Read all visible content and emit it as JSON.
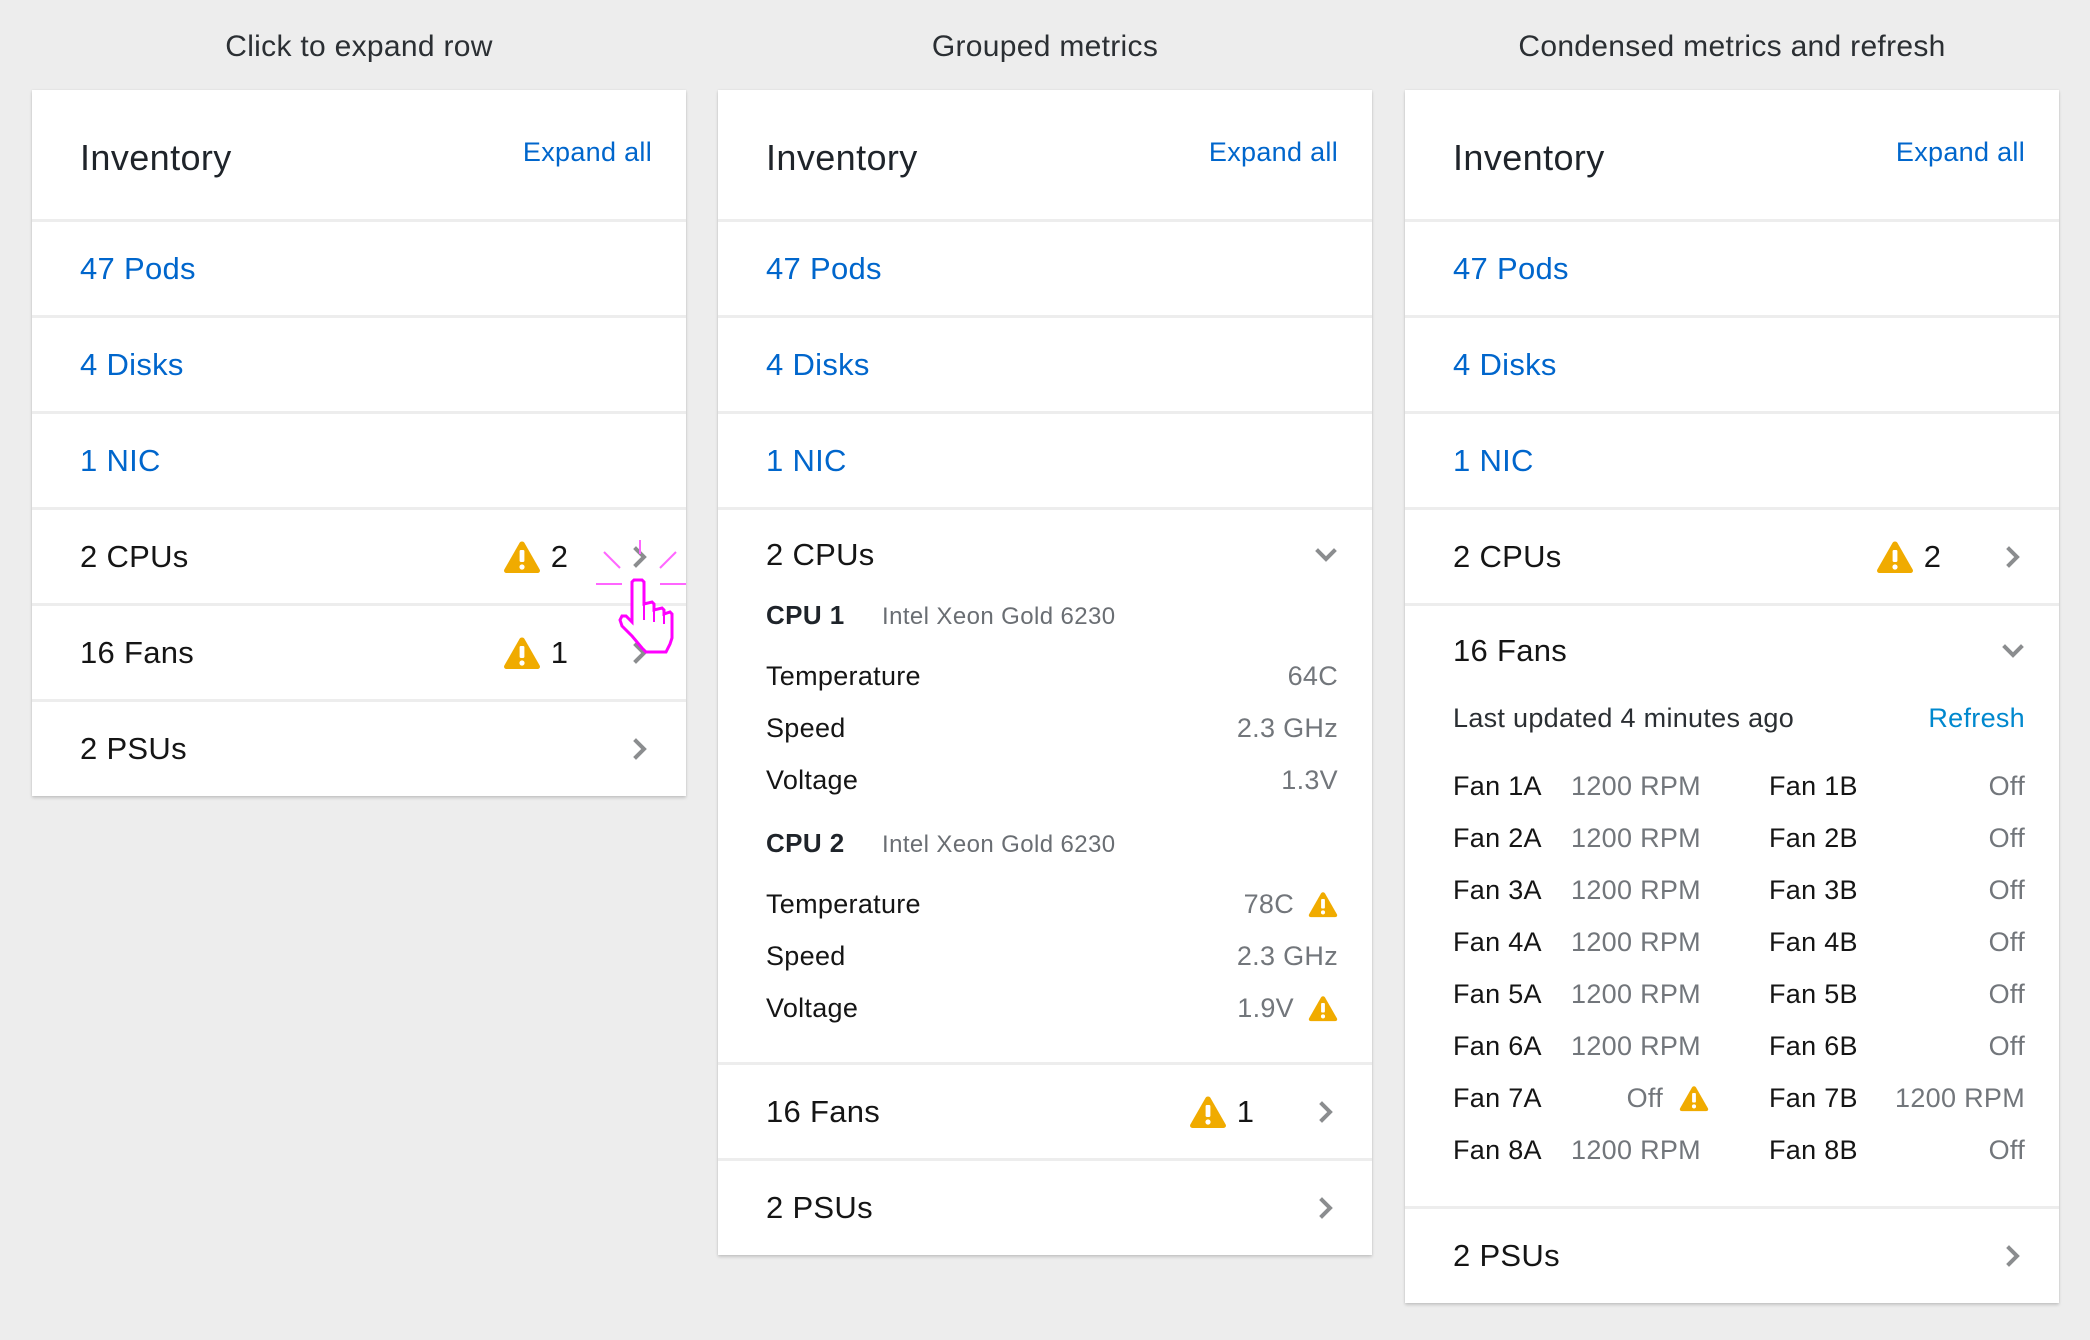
{
  "colors": {
    "background": "#ededed",
    "link": "#0066cc",
    "refresh_link": "#0088ce",
    "warning": "#f0ab00",
    "muted_text": "#72767b",
    "chevron": "#8b8d8f",
    "cursor_highlight": "#ff00ff"
  },
  "columns": [
    {
      "heading": "Click to expand row",
      "panel": {
        "title": "Inventory",
        "expand_all": "Expand all",
        "rows": [
          {
            "label": "47 Pods",
            "type": "link"
          },
          {
            "label": "4 Disks",
            "type": "link"
          },
          {
            "label": "1 NIC",
            "type": "link"
          },
          {
            "label": "2 CPUs",
            "type": "expandable",
            "alert_icon": "warning-icon",
            "alert_count": "2",
            "chevron": "chevron-right-icon"
          },
          {
            "label": "16 Fans",
            "type": "expandable",
            "alert_icon": "warning-icon",
            "alert_count": "1",
            "chevron": "chevron-right-icon"
          },
          {
            "label": "2 PSUs",
            "type": "expandable",
            "chevron": "chevron-right-icon"
          }
        ]
      },
      "cursor": "hand-pointer-click-icon"
    },
    {
      "heading": "Grouped metrics",
      "panel": {
        "title": "Inventory",
        "expand_all": "Expand all",
        "rows": [
          {
            "label": "47 Pods",
            "type": "link"
          },
          {
            "label": "4 Disks",
            "type": "link"
          },
          {
            "label": "1 NIC",
            "type": "link"
          },
          {
            "label": "2 CPUs",
            "type": "expanded",
            "chevron": "chevron-down-icon"
          },
          {
            "label": "16 Fans",
            "type": "expandable",
            "alert_icon": "warning-icon",
            "alert_count": "1",
            "chevron": "chevron-right-icon"
          },
          {
            "label": "2 PSUs",
            "type": "expandable",
            "chevron": "chevron-right-icon"
          }
        ],
        "cpus": [
          {
            "name": "CPU 1",
            "model": "Intel Xeon Gold 6230",
            "metrics": [
              {
                "label": "Temperature",
                "value": "64C",
                "warning": false
              },
              {
                "label": "Speed",
                "value": "2.3 GHz",
                "warning": false
              },
              {
                "label": "Voltage",
                "value": "1.3V",
                "warning": false
              }
            ]
          },
          {
            "name": "CPU 2",
            "model": "Intel Xeon Gold 6230",
            "metrics": [
              {
                "label": "Temperature",
                "value": "78C",
                "warning": true
              },
              {
                "label": "Speed",
                "value": "2.3 GHz",
                "warning": false
              },
              {
                "label": "Voltage",
                "value": "1.9V",
                "warning": true
              }
            ]
          }
        ]
      }
    },
    {
      "heading": "Condensed metrics and refresh",
      "panel": {
        "title": "Inventory",
        "expand_all": "Expand all",
        "rows": [
          {
            "label": "47 Pods",
            "type": "link"
          },
          {
            "label": "4 Disks",
            "type": "link"
          },
          {
            "label": "1 NIC",
            "type": "link"
          },
          {
            "label": "2 CPUs",
            "type": "expandable",
            "alert_icon": "warning-icon",
            "alert_count": "2",
            "chevron": "chevron-right-icon"
          },
          {
            "label": "16 Fans",
            "type": "expanded",
            "chevron": "chevron-down-icon"
          },
          {
            "label": "2 PSUs",
            "type": "expandable",
            "chevron": "chevron-right-icon"
          }
        ],
        "fans": {
          "updated_text": "Last updated 4 minutes ago",
          "refresh_label": "Refresh",
          "items": [
            {
              "name": "Fan 1A",
              "value": "1200 RPM",
              "warning": false
            },
            {
              "name": "Fan 1B",
              "value": "Off",
              "warning": false
            },
            {
              "name": "Fan 2A",
              "value": "1200 RPM",
              "warning": false
            },
            {
              "name": "Fan 2B",
              "value": "Off",
              "warning": false
            },
            {
              "name": "Fan 3A",
              "value": "1200 RPM",
              "warning": false
            },
            {
              "name": "Fan 3B",
              "value": "Off",
              "warning": false
            },
            {
              "name": "Fan 4A",
              "value": "1200 RPM",
              "warning": false
            },
            {
              "name": "Fan 4B",
              "value": "Off",
              "warning": false
            },
            {
              "name": "Fan 5A",
              "value": "1200 RPM",
              "warning": false
            },
            {
              "name": "Fan 5B",
              "value": "Off",
              "warning": false
            },
            {
              "name": "Fan 6A",
              "value": "1200 RPM",
              "warning": false
            },
            {
              "name": "Fan 6B",
              "value": "Off",
              "warning": false
            },
            {
              "name": "Fan 7A",
              "value": "Off",
              "warning": true
            },
            {
              "name": "Fan 7B",
              "value": "1200 RPM",
              "warning": false
            },
            {
              "name": "Fan 8A",
              "value": "1200 RPM",
              "warning": false
            },
            {
              "name": "Fan 8B",
              "value": "Off",
              "warning": false
            }
          ]
        }
      }
    }
  ]
}
